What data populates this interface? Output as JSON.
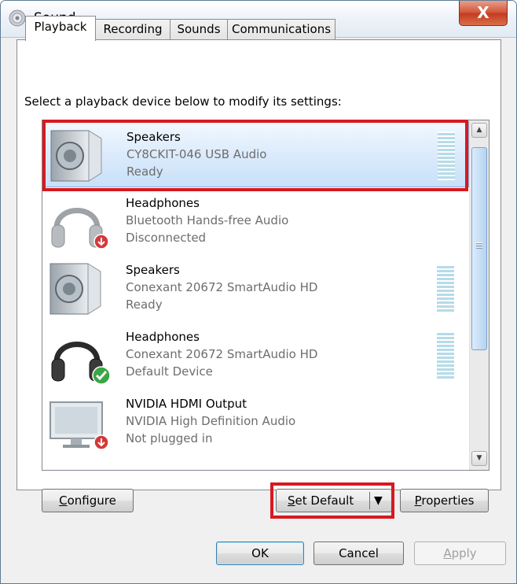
{
  "window": {
    "title": "Sound",
    "close_label": "X"
  },
  "tabs": [
    {
      "label": "Playback",
      "active": true
    },
    {
      "label": "Recording",
      "active": false
    },
    {
      "label": "Sounds",
      "active": false
    },
    {
      "label": "Communications",
      "active": false
    }
  ],
  "instruction": "Select a playback device below to modify its settings:",
  "devices": [
    {
      "name": "Speakers",
      "driver": "CY8CKIT-046 USB Audio",
      "status": "Ready",
      "icon": "speaker-icon",
      "selected": true
    },
    {
      "name": "Headphones",
      "driver": "Bluetooth Hands-free Audio",
      "status": "Disconnected",
      "icon": "headphones-icon",
      "badge": "down-arrow-badge-icon"
    },
    {
      "name": "Speakers",
      "driver": "Conexant 20672 SmartAudio HD",
      "status": "Ready",
      "icon": "speaker-icon"
    },
    {
      "name": "Headphones",
      "driver": "Conexant 20672 SmartAudio HD",
      "status": "Default Device",
      "icon": "headphones-icon",
      "badge": "green-check-badge-icon"
    },
    {
      "name": "NVIDIA HDMI Output",
      "driver": "NVIDIA High Definition Audio",
      "status": "Not plugged in",
      "icon": "monitor-icon",
      "badge": "down-arrow-badge-icon"
    }
  ],
  "buttons": {
    "configure_a": "C",
    "configure_b": "onfigure",
    "set_default_a": "S",
    "set_default_b": "et Default",
    "properties_a": "P",
    "properties_b": "roperties",
    "ok": "OK",
    "cancel": "Cancel",
    "apply_a": "A",
    "apply_b": "pply"
  },
  "colors": {
    "highlight": "#d71920",
    "selection": "#dcebfc"
  }
}
